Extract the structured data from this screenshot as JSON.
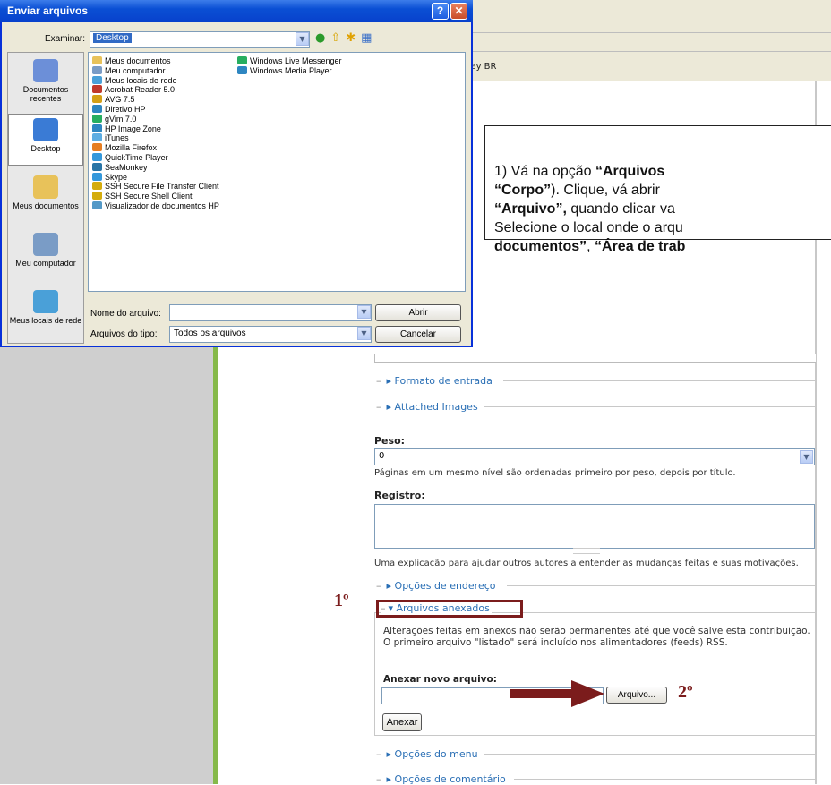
{
  "browser": {
    "bookmark_text": "key BR"
  },
  "form": {
    "formato_entrada": "Formato de entrada",
    "attached_images": "Attached Images",
    "peso_label": "Peso:",
    "peso_value": "0",
    "peso_desc": "Páginas em um mesmo nível são ordenadas primeiro por peso, depois por título.",
    "registro_label": "Registro:",
    "registro_desc": "Uma explicação para ajudar outros autores a entender as mudanças feitas e suas motivações.",
    "opcoes_endereco": "Opções de endereço",
    "arquivos_anexados": "Arquivos anexados",
    "anexos_desc": "Alterações feitas em anexos não serão permanentes até que você salve esta contribuição. O primeiro arquivo \"listado\" será incluído nos alimentadores (feeds) RSS.",
    "anexar_novo_label": "Anexar novo arquivo:",
    "arquivo_button": "Arquivo...",
    "anexar_button": "Anexar",
    "opcoes_menu": "Opções do menu",
    "opcoes_comentario": "Opções de comentário"
  },
  "annotations": {
    "step1": "1º",
    "step2": "2º",
    "color": "#7b1c1c"
  },
  "instruction": {
    "line1_a": "1) Vá na opção ",
    "line1_b": "“Arquivos",
    "line2_a": "“Corpo”",
    "line2_b": "). Clique, vá abrir",
    "line3_a": "“Arquivo”,",
    "line3_b": " quando clicar va",
    "line4": "Selecione o local onde o arqu",
    "line5_a": "documentos”",
    "line5_b": ", ",
    "line5_c": "“Área de trab"
  },
  "dialog": {
    "title": "Enviar arquivos",
    "help": "?",
    "close": "✕",
    "examinar_label": "Examinar:",
    "examinar_value": "Desktop",
    "places": [
      {
        "label": "Documentos recentes",
        "color": "#6c8fd8"
      },
      {
        "label": "Desktop",
        "color": "#3a7bd5"
      },
      {
        "label": "Meus documentos",
        "color": "#e8c25a"
      },
      {
        "label": "Meu computador",
        "color": "#7a9cc6"
      },
      {
        "label": "Meus locais de rede",
        "color": "#4aa0d8"
      }
    ],
    "files_col1": [
      "Meus documentos",
      "Meu computador",
      "Meus locais de rede",
      "Acrobat Reader 5.0",
      "AVG 7.5",
      "Diretivo HP",
      "gVim 7.0",
      "HP  Image Zone",
      "iTunes",
      "Mozilla Firefox",
      "QuickTime Player",
      "SeaMonkey",
      "Skype",
      "SSH Secure File Transfer Client",
      "SSH Secure Shell Client",
      "Visualizador de documentos HP"
    ],
    "files_col2": [
      "Windows Live Messenger",
      "Windows Media Player"
    ],
    "nome_label": "Nome do arquivo:",
    "nome_value": "",
    "tipo_label": "Arquivos do tipo:",
    "tipo_value": "Todos os arquivos",
    "abrir": "Abrir",
    "cancelar": "Cancelar"
  }
}
